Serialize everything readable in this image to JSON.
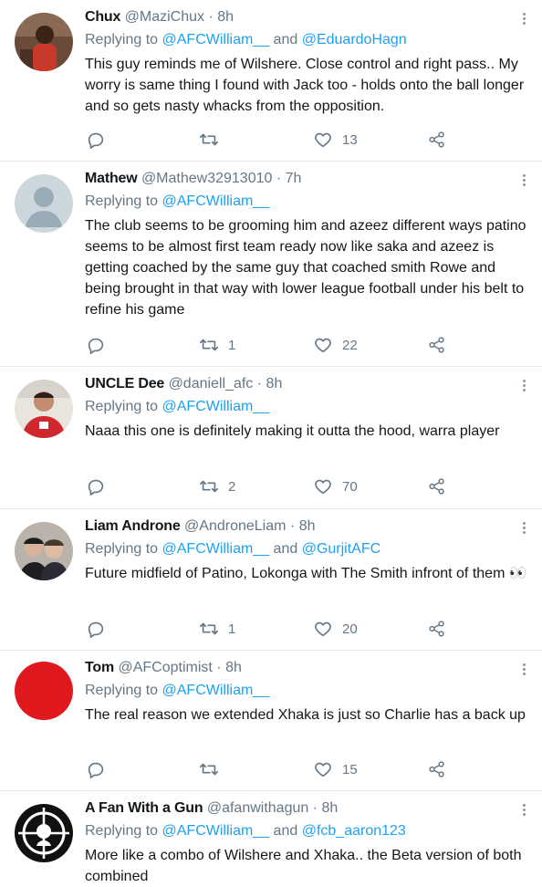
{
  "tweets": [
    {
      "name": "Chux",
      "handle": "@MaziChux",
      "dot": "·",
      "time": "8h",
      "replying_prefix": "Replying to",
      "mentions": [
        "@AFCWilliam__",
        "@EduardoHagn"
      ],
      "and": "and",
      "text": "This guy reminds me of Wilshere. Close control and right pass.. My worry is same thing I found with Jack too - holds onto the ball longer and so gets nasty whacks from the opposition.",
      "reply_count": "",
      "retweet_count": "",
      "like_count": "13"
    },
    {
      "name": "Mathew",
      "handle": "@Mathew32913010",
      "dot": "·",
      "time": "7h",
      "replying_prefix": "Replying to",
      "mentions": [
        "@AFCWilliam__"
      ],
      "and": "",
      "text": "The club seems to be grooming him and azeez different ways patino seems to be almost first team ready now like saka  and azeez is getting coached by the same guy that coached smith Rowe and being brought in that way with lower league football under his belt to refine his game",
      "reply_count": "",
      "retweet_count": "1",
      "like_count": "22"
    },
    {
      "name": "UNCLE Dee",
      "handle": "@daniell_afc",
      "dot": "·",
      "time": "8h",
      "replying_prefix": "Replying to",
      "mentions": [
        "@AFCWilliam__"
      ],
      "and": "",
      "text": "Naaa this one is definitely making it outta the hood, warra player",
      "reply_count": "",
      "retweet_count": "2",
      "like_count": "70"
    },
    {
      "name": "Liam Androne",
      "handle": "@AndroneLiam",
      "dot": "·",
      "time": "8h",
      "replying_prefix": "Replying to",
      "mentions": [
        "@AFCWilliam__",
        "@GurjitAFC"
      ],
      "and": "and",
      "text": "Future midfield of Patino, Lokonga with The Smith infront of them 👀",
      "reply_count": "",
      "retweet_count": "1",
      "like_count": "20"
    },
    {
      "name": "Tom",
      "handle": "@AFCoptimist",
      "dot": "·",
      "time": "8h",
      "replying_prefix": "Replying to",
      "mentions": [
        "@AFCWilliam__"
      ],
      "and": "",
      "text": "The real reason we extended Xhaka is just so Charlie has a back up",
      "reply_count": "",
      "retweet_count": "",
      "like_count": "15"
    },
    {
      "name": "A Fan With a Gun",
      "handle": "@afanwithagun",
      "dot": "·",
      "time": "8h",
      "replying_prefix": "Replying to",
      "mentions": [
        "@AFCWilliam__",
        "@fcb_aaron123"
      ],
      "and": "and",
      "text": "More like a combo of Wilshere and Xhaka.. the Beta version of both combined",
      "reply_count": "",
      "retweet_count": "",
      "like_count": ""
    }
  ],
  "colors": {
    "mention": "#1da1f2",
    "muted": "#657786",
    "text": "#14171a",
    "divider": "#e1e8ed"
  },
  "icons": [
    "reply-icon",
    "retweet-icon",
    "like-icon",
    "share-icon",
    "more-icon"
  ]
}
